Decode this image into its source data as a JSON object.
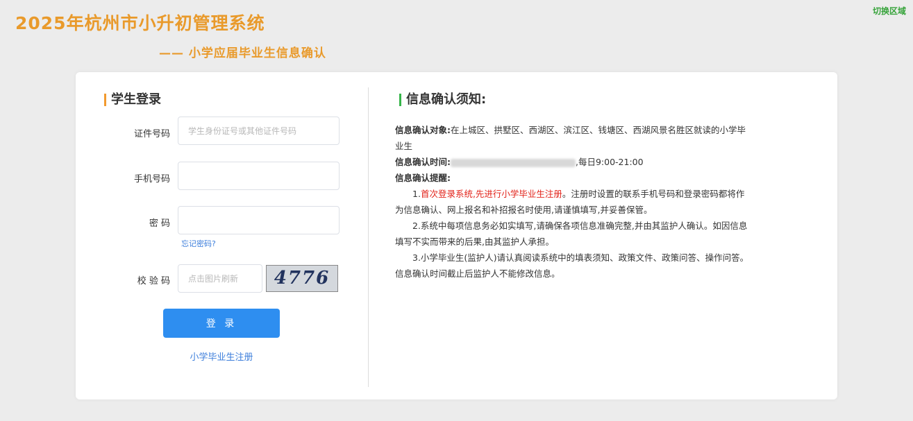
{
  "header": {
    "title": "2025年杭州市小升初管理系统",
    "subtitle": "—— 小学应届毕业生信息确认",
    "switch_region": "切换区域"
  },
  "login": {
    "title": "学生登录",
    "id_label": "证件号码",
    "id_placeholder": "学生身份证号或其他证件号码",
    "phone_label": "手机号码",
    "phone_value": "",
    "password_label": "密 码",
    "password_value": "",
    "forgot": "忘记密码?",
    "captcha_label": "校 验 码",
    "captcha_placeholder": "点击图片刷新",
    "captcha_code": "4776",
    "login_button": "登 录",
    "register_link": "小学毕业生注册"
  },
  "notice": {
    "title": "信息确认须知:",
    "target_label": "信息确认对象:",
    "target_text": "在上城区、拱墅区、西湖区、滨江区、钱塘区、西湖风景名胜区就读的小学毕业生",
    "time_label": "信息确认时间:",
    "time_suffix": ",每日9:00-21:00",
    "reminder_label": "信息确认提醒:",
    "item1_prefix": "1.",
    "item1_red": "首次登录系统,先进行小学毕业生注册",
    "item1_rest": "。注册时设置的联系手机号码和登录密码都将作为信息确认、网上报名和补招报名时使用,请谨慎填写,并妥善保管。",
    "item2": "2.系统中每项信息务必如实填写,请确保各项信息准确完整,并由其监护人确认。如因信息填写不实而带来的后果,由其监护人承担。",
    "item3": "3.小学毕业生(监护人)请认真阅读系统中的填表须知、政策文件、政策问答、操作问答。信息确认时间截止后监护人不能修改信息。"
  },
  "colors": {
    "title": "#e99a2b",
    "switch": "#36a33a",
    "login_button": "#2e8ef0",
    "link": "#3b7ddb",
    "red": "#e2231a",
    "login_bar": "#f29a2e",
    "notice_bar": "#36b54a"
  }
}
